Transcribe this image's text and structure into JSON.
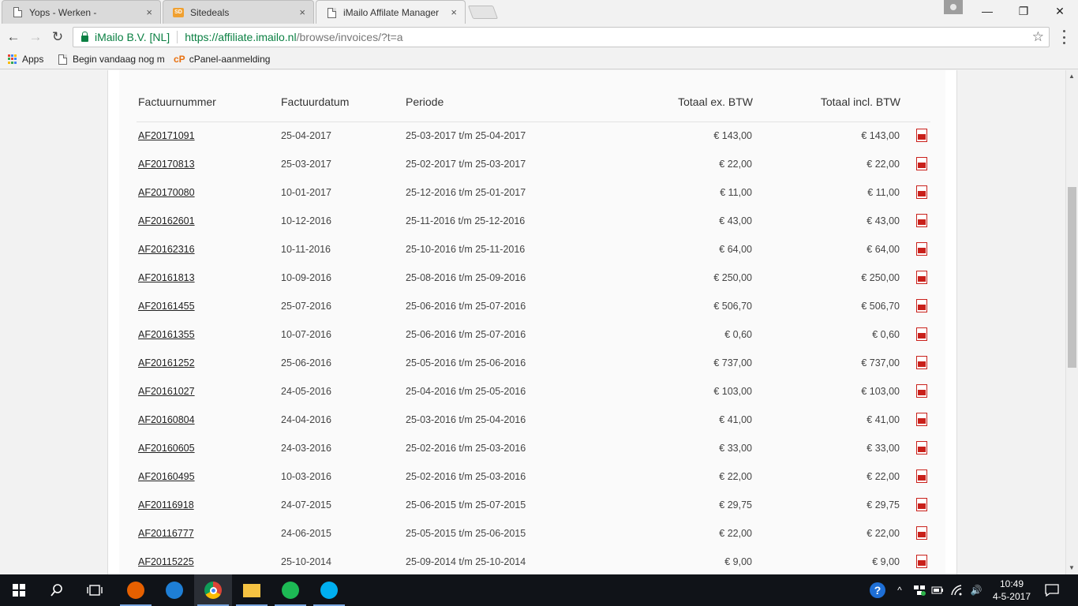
{
  "browser": {
    "tabs": [
      {
        "title": "Yops - Werken -",
        "icon": "document-icon",
        "active": false
      },
      {
        "title": "Sitedeals",
        "icon": "sitedeals-icon",
        "active": false
      },
      {
        "title": "iMailo Affilate Manager",
        "icon": "document-icon",
        "active": true
      }
    ],
    "close_glyph": "×",
    "window_controls": {
      "minimize": "—",
      "restore": "❐",
      "close": "✕"
    },
    "nav": {
      "back": "←",
      "forward": "→",
      "reload": "↻"
    },
    "address": {
      "org": "iMailo B.V. [NL]",
      "url_base": "https://affiliate.imailo.nl",
      "url_rest": "/browse/invoices/?t=a"
    },
    "star": "☆",
    "bookmarks": [
      {
        "label": "Apps",
        "icon": "apps-grid-icon"
      },
      {
        "label": "Begin vandaag nog m",
        "icon": "document-icon"
      },
      {
        "label": "cPanel-aanmelding",
        "icon": "cpanel-icon"
      }
    ]
  },
  "invoices": {
    "headers": {
      "number": "Factuurnummer",
      "date": "Factuurdatum",
      "period": "Periode",
      "total_ex": "Totaal ex. BTW",
      "total_incl": "Totaal incl. BTW"
    },
    "rows": [
      {
        "number": "AF20171091",
        "date": "25-04-2017",
        "period": "25-03-2017 t/m 25-04-2017",
        "total_ex": "€ 143,00",
        "total_incl": "€ 143,00"
      },
      {
        "number": "AF20170813",
        "date": "25-03-2017",
        "period": "25-02-2017 t/m 25-03-2017",
        "total_ex": "€ 22,00",
        "total_incl": "€ 22,00"
      },
      {
        "number": "AF20170080",
        "date": "10-01-2017",
        "period": "25-12-2016 t/m 25-01-2017",
        "total_ex": "€ 11,00",
        "total_incl": "€ 11,00"
      },
      {
        "number": "AF20162601",
        "date": "10-12-2016",
        "period": "25-11-2016 t/m 25-12-2016",
        "total_ex": "€ 43,00",
        "total_incl": "€ 43,00"
      },
      {
        "number": "AF20162316",
        "date": "10-11-2016",
        "period": "25-10-2016 t/m 25-11-2016",
        "total_ex": "€ 64,00",
        "total_incl": "€ 64,00"
      },
      {
        "number": "AF20161813",
        "date": "10-09-2016",
        "period": "25-08-2016 t/m 25-09-2016",
        "total_ex": "€ 250,00",
        "total_incl": "€ 250,00"
      },
      {
        "number": "AF20161455",
        "date": "25-07-2016",
        "period": "25-06-2016 t/m 25-07-2016",
        "total_ex": "€ 506,70",
        "total_incl": "€ 506,70"
      },
      {
        "number": "AF20161355",
        "date": "10-07-2016",
        "period": "25-06-2016 t/m 25-07-2016",
        "total_ex": "€ 0,60",
        "total_incl": "€ 0,60"
      },
      {
        "number": "AF20161252",
        "date": "25-06-2016",
        "period": "25-05-2016 t/m 25-06-2016",
        "total_ex": "€ 737,00",
        "total_incl": "€ 737,00"
      },
      {
        "number": "AF20161027",
        "date": "24-05-2016",
        "period": "25-04-2016 t/m 25-05-2016",
        "total_ex": "€ 103,00",
        "total_incl": "€ 103,00"
      },
      {
        "number": "AF20160804",
        "date": "24-04-2016",
        "period": "25-03-2016 t/m 25-04-2016",
        "total_ex": "€ 41,00",
        "total_incl": "€ 41,00"
      },
      {
        "number": "AF20160605",
        "date": "24-03-2016",
        "period": "25-02-2016 t/m 25-03-2016",
        "total_ex": "€ 33,00",
        "total_incl": "€ 33,00"
      },
      {
        "number": "AF20160495",
        "date": "10-03-2016",
        "period": "25-02-2016 t/m 25-03-2016",
        "total_ex": "€ 22,00",
        "total_incl": "€ 22,00"
      },
      {
        "number": "AF20116918",
        "date": "24-07-2015",
        "period": "25-06-2015 t/m 25-07-2015",
        "total_ex": "€ 29,75",
        "total_incl": "€ 29,75"
      },
      {
        "number": "AF20116777",
        "date": "24-06-2015",
        "period": "25-05-2015 t/m 25-06-2015",
        "total_ex": "€ 22,00",
        "total_incl": "€ 22,00"
      },
      {
        "number": "AF20115225",
        "date": "25-10-2014",
        "period": "25-09-2014 t/m 25-10-2014",
        "total_ex": "€ 9,00",
        "total_incl": "€ 9,00"
      }
    ],
    "download_icon": "pdf-icon"
  },
  "taskbar": {
    "apps": [
      {
        "name": "firefox",
        "icon": "firefox-icon",
        "color": "#e66000",
        "open": true
      },
      {
        "name": "edge",
        "icon": "edge-icon",
        "color": "#1e7fd6",
        "open": false
      },
      {
        "name": "chrome",
        "icon": "chrome-icon",
        "color": "#db4437",
        "open": true
      },
      {
        "name": "file-explorer",
        "icon": "folder-icon",
        "color": "#f5c242",
        "open": true
      },
      {
        "name": "spotify",
        "icon": "spotify-icon",
        "color": "#1db954",
        "open": true
      },
      {
        "name": "skype",
        "icon": "skype-icon",
        "color": "#00aff0",
        "open": true
      }
    ],
    "time": "10:49",
    "date": "4-5-2017",
    "tray_chevron": "^",
    "volume": "🔊"
  }
}
